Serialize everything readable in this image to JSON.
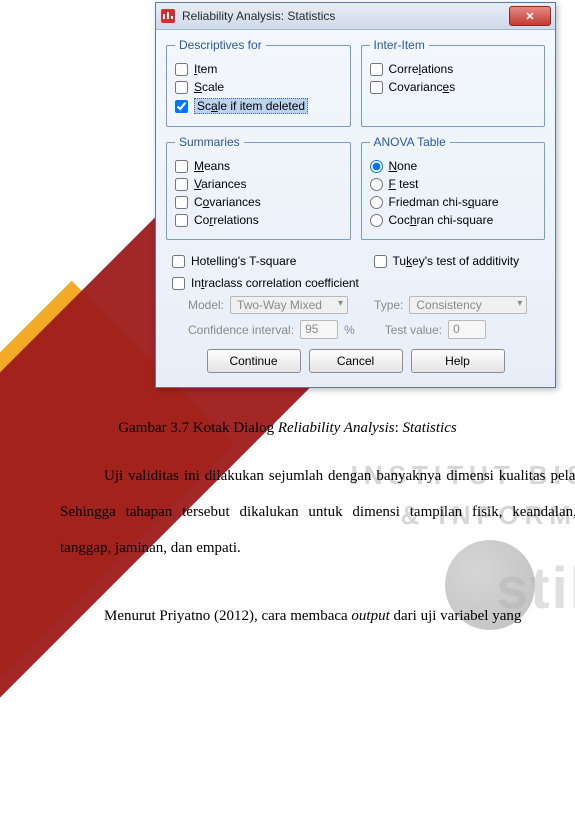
{
  "dialog": {
    "title": "Reliability Analysis: Statistics",
    "close_glyph": "✕",
    "groups": {
      "descriptives": {
        "legend": "Descriptives for",
        "item": "Item",
        "scale": "Scale",
        "scale_if_deleted": "Scale if item deleted"
      },
      "inter_item": {
        "legend": "Inter-Item",
        "correlations": "Correlations",
        "covariances": "Covariances"
      },
      "summaries": {
        "legend": "Summaries",
        "means": "Means",
        "variances": "Variances",
        "covariances": "Covariances",
        "correlations": "Correlations"
      },
      "anova": {
        "legend": "ANOVA Table",
        "none": "None",
        "ftest": "F test",
        "friedman": "Friedman chi-square",
        "cochran": "Cochran chi-square"
      }
    },
    "lower": {
      "hotelling": "Hotelling's T-square",
      "tukey": "Tukey's test of additivity",
      "intraclass": "Intraclass correlation coefficient"
    },
    "disabled": {
      "model_label": "Model:",
      "model_value": "Two-Way Mixed",
      "type_label": "Type:",
      "type_value": "Consistency",
      "ci_label": "Confidence interval:",
      "ci_value": "95",
      "ci_pct": "%",
      "test_label": "Test value:",
      "test_value": "0"
    },
    "buttons": {
      "continue": "Continue",
      "cancel": "Cancel",
      "help": "Help"
    }
  },
  "caption": "Gambar 3.7 Kotak Dialog Reliability Analysis: Statistics",
  "paragraph1": "Uji validitas ini dilakukan sejumlah dengan banyaknya dimensi kualitas pelayanan. Sehingga tahapan tersebut dikalukan untuk dimensi tampilan fisik, keandalan, daya tanggap,  jaminan, dan empati.",
  "paragraph2": "Menurut Priyatno (2012), cara membaca output dari uji variabel yang",
  "watermark": {
    "line1": "INSTITUT BISN",
    "line2": "& INFORMATI",
    "brand": "stikom"
  }
}
